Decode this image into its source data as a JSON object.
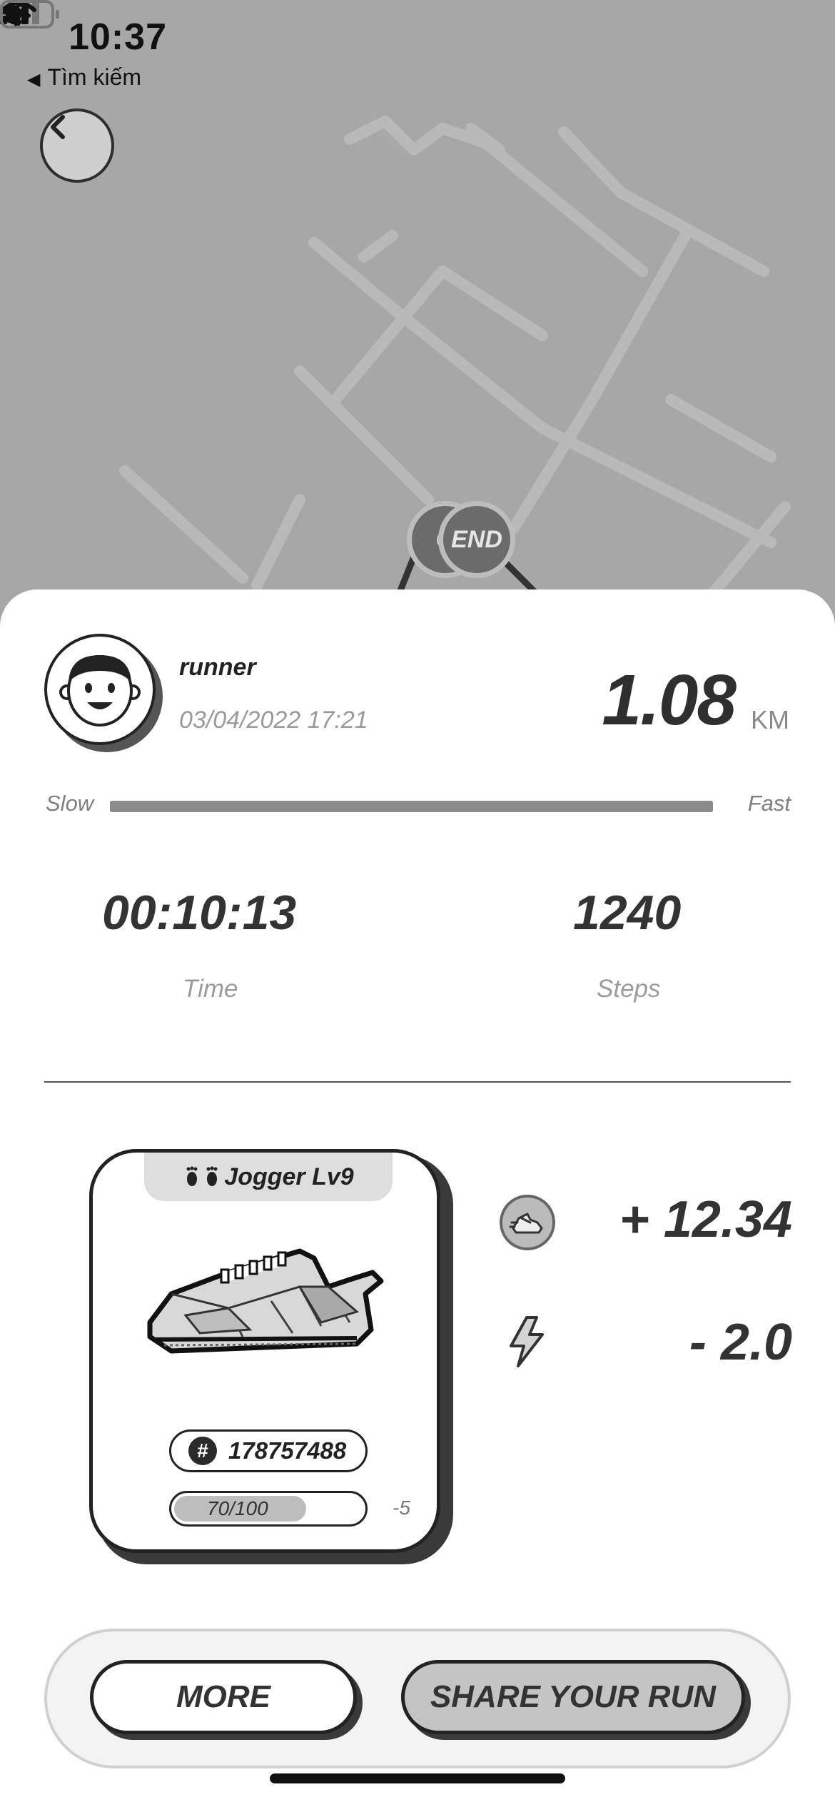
{
  "status_bar": {
    "time": "10:37",
    "back_app": "Tìm kiếm",
    "icons": [
      "location-arrow-icon",
      "cellular-signal-icon",
      "wifi-icon",
      "battery-icon"
    ]
  },
  "map": {
    "start_marker": "G",
    "end_marker": "END"
  },
  "summary": {
    "username": "runner",
    "date": "03/04/2022 17:21",
    "distance": "1.08",
    "distance_unit": "KM",
    "speed_slow_label": "Slow",
    "speed_fast_label": "Fast",
    "time_value": "00:10:13",
    "time_label": "Time",
    "steps_value": "1240",
    "steps_label": "Steps"
  },
  "shoe": {
    "class_label": "Jogger Lv9",
    "id": "178757488",
    "durability_text": "70/100",
    "durability_value": 70,
    "durability_max": 100,
    "durability_delta": "-5"
  },
  "earnings": {
    "token_gain": "+ 12.34",
    "energy_change": "- 2.0"
  },
  "actions": {
    "more_label": "MORE",
    "share_label": "SHARE YOUR RUN"
  },
  "colors": {
    "map_bg": "#a7a7a7",
    "map_road": "#b9b9b9",
    "sheet_bg": "#ffffff",
    "accent_dark": "#2f2f2f"
  }
}
